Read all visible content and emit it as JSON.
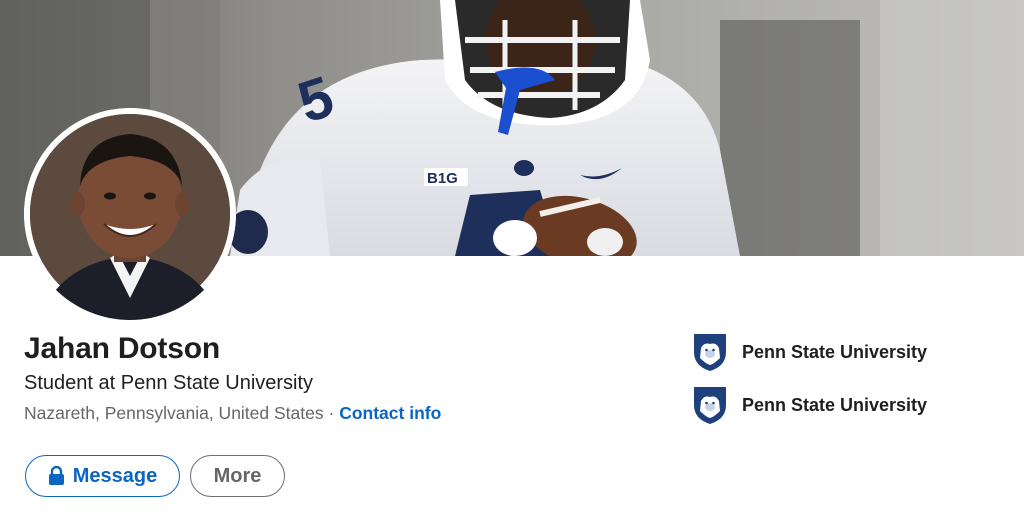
{
  "profile": {
    "name": "Jahan Dotson",
    "headline": "Student at Penn State University",
    "location": "Nazareth, Pennsylvania, United States",
    "separator": "·",
    "contact_info_label": "Contact info"
  },
  "actions": {
    "message_label": "Message",
    "more_label": "More"
  },
  "education": [
    {
      "label": "Penn State University",
      "icon": "penn-state-shield-icon"
    },
    {
      "label": "Penn State University",
      "icon": "penn-state-shield-icon"
    }
  ],
  "colors": {
    "link_blue": "#0a66c2",
    "text_primary": "#1f1f1f",
    "text_secondary": "#666666",
    "penn_state_navy": "#1e407c"
  }
}
